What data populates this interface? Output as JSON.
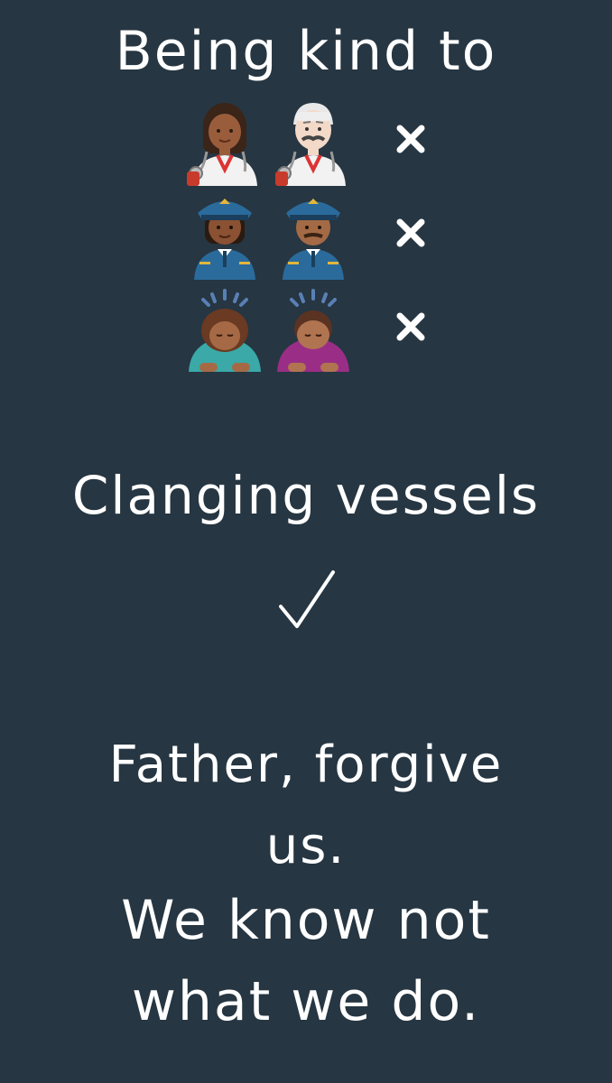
{
  "title": "Being kind to",
  "rows": [
    {
      "left_icon": "woman-health-worker-emoji",
      "right_icon": "man-health-worker-emoji",
      "mark": "cross-mark-icon"
    },
    {
      "left_icon": "woman-pilot-emoji",
      "right_icon": "man-pilot-emoji",
      "mark": "cross-mark-icon"
    },
    {
      "left_icon": "woman-bowing-emoji",
      "right_icon": "man-bowing-emoji",
      "mark": "cross-mark-icon"
    }
  ],
  "second_line": "Clanging vessels",
  "second_mark": "check-mark-icon",
  "closing_lines": [
    "Father, forgive",
    "us.",
    "We know not",
    "what we do."
  ],
  "colors": {
    "background": "#263642",
    "text": "#ffffff"
  }
}
